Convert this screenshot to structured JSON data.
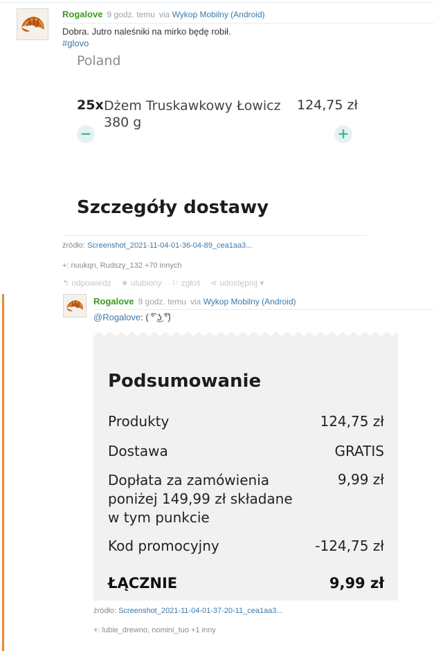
{
  "post1": {
    "author": "Rogalove",
    "time": "9 godz. temu",
    "via": "via",
    "client": "Wykop Mobilny (Android)",
    "text": "Dobra. Jutro naleśniki na mirko będę robił.",
    "tag": "#glovo",
    "embed": {
      "country": "Poland",
      "qty": "25x",
      "product_line1": "Dżem Truskawkowy Łowicz",
      "product_line2": "380 g",
      "price": "124,75 zł",
      "minus": "−",
      "plus": "+",
      "section_title": "Szczegóły dostawy"
    },
    "source_label": "źródło:",
    "source_file": "Screenshot_2021-11-04-01-36-04-89_cea1aa3...",
    "votes": "+: nuukqn, Rudszy_132 +70 innych",
    "actions": {
      "reply": "odpowiedz",
      "fav": "ulubiony",
      "report": "zgłoś",
      "share": "udostępnij"
    }
  },
  "post2": {
    "author": "Rogalove",
    "time": "9 godz. temu",
    "via": "via",
    "client": "Wykop Mobilny (Android)",
    "mention": "@Rogalove",
    "text_rest": ": ( ͡° ͜ʖ ͡°)",
    "receipt": {
      "title": "Podsumowanie",
      "rows": [
        {
          "label": "Produkty",
          "value": "124,75 zł"
        },
        {
          "label": "Dostawa",
          "value": "GRATIS"
        },
        {
          "label": "Dopłata za zamówienia",
          "label2": "poniżej 149,99 zł składane",
          "label3": "w tym punkcie",
          "value": "9,99 zł"
        },
        {
          "label": "Kod promocyjny",
          "value": "-124,75 zł"
        }
      ],
      "total_label": "ŁĄCZNIE",
      "total_value": "9,99 zł"
    },
    "source_label": "źródło:",
    "source_file": "Screenshot_2021-11-04-01-37-20-11_cea1aa3...",
    "votes": "+: lubie_drewno, nomini_tuo +1 inny"
  },
  "colors": {
    "accent_bar": "#e5892f",
    "author": "#3a9a20",
    "link": "#3b78a9",
    "plus_minus": "#3fb59a"
  },
  "icons": [
    "croissant-icon",
    "reply-icon",
    "star-icon",
    "flag-icon",
    "share-icon",
    "chevron-down-icon"
  ]
}
